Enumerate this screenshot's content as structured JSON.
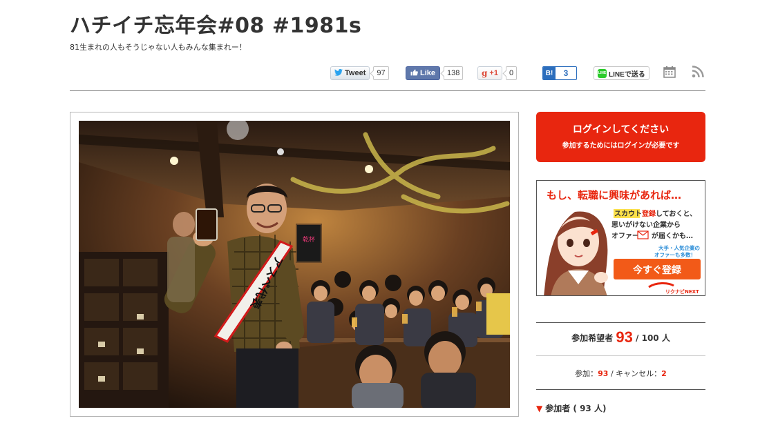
{
  "event": {
    "title": "ハチイチ忘年会#08 #1981s",
    "subtitle": "81生まれの人もそうじゃない人もみんな集まれー！"
  },
  "social": {
    "tweet_label": "Tweet",
    "tweet_count": "97",
    "like_label": "Like",
    "like_count": "138",
    "gplus_label": "+1",
    "gplus_count": "0",
    "hatena_label": "B!",
    "hatena_count": "3",
    "line_label": "LINEで送る",
    "line_icon_text": "LINE",
    "calendar_icon": "calendar-icon",
    "rss_icon": "rss-icon"
  },
  "photo": {
    "sash_text": "アスペ代表"
  },
  "login": {
    "title": "ログインしてください",
    "subtitle": "参加するためにはログインが必要です"
  },
  "ad": {
    "headline": "もし、転職に興味があれば…",
    "line1_a": "スカウト",
    "line1_b": "登録",
    "line1_c": "しておくと、",
    "line2": "思いがけない企業から",
    "line3_a": "オファー",
    "line3_b": "が届くかも…",
    "note1": "大手・人気企業の",
    "note2": "オファーも多数！",
    "cta": "今すぐ登録",
    "brand": "リクナビNEXT"
  },
  "stats": {
    "want_label": "参加希望者",
    "want_count": "93",
    "want_capacity": "/ 100 人",
    "join_label": "参加：",
    "join_count": "93",
    "sep_cancel": " / キャンセル：",
    "cancel_count": "2",
    "participants_label": "参加者 ( 93 人)"
  },
  "colors": {
    "accent_red": "#e8260f",
    "facebook_blue": "#5f78ab",
    "hatena_blue": "#2c6ebd",
    "twitter_blue": "#2aa3ef",
    "line_green": "#2ccb2c"
  }
}
